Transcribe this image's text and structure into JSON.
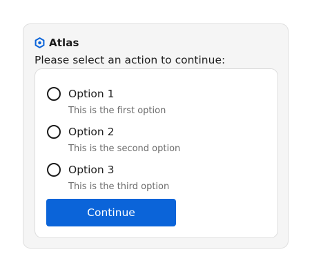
{
  "brand": {
    "name": "Atlas",
    "icon": "hexagon-logo-icon",
    "color": "#0b64d9"
  },
  "prompt": "Please select an action to continue:",
  "options": [
    {
      "label": "Option 1",
      "description": "This is the first option",
      "selected": false
    },
    {
      "label": "Option 2",
      "description": "This is the second option",
      "selected": false
    },
    {
      "label": "Option 3",
      "description": "This is the third option",
      "selected": false
    }
  ],
  "continue_button": {
    "label": "Continue",
    "color": "#0b64d9"
  }
}
